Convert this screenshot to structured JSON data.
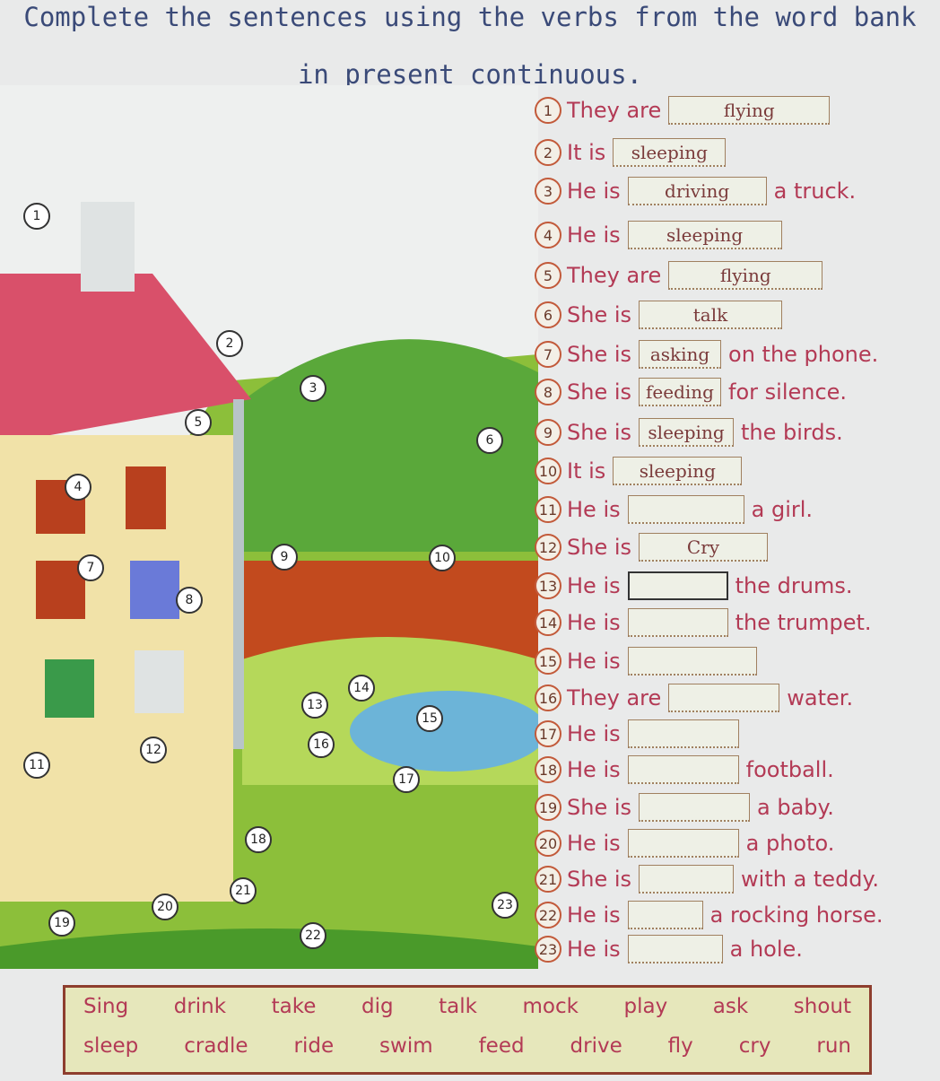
{
  "title_line1": "Complete the sentences using the verbs from the word bank",
  "title_line2": "in present continuous.",
  "sentences": [
    {
      "n": "1",
      "before": "They are",
      "answer": "flying",
      "after": ""
    },
    {
      "n": "2",
      "before": "It is",
      "answer": "sleeping",
      "after": ""
    },
    {
      "n": "3",
      "before": "He is",
      "answer": "driving",
      "after": "a truck."
    },
    {
      "n": "4",
      "before": "He is",
      "answer": "sleeping",
      "after": ""
    },
    {
      "n": "5",
      "before": "They are",
      "answer": "flying",
      "after": ""
    },
    {
      "n": "6",
      "before": "She is",
      "answer": "talk",
      "after": ""
    },
    {
      "n": "7",
      "before": "She is",
      "answer": "asking",
      "after": "on the phone."
    },
    {
      "n": "8",
      "before": "She is",
      "answer": "feeding",
      "after": "for silence."
    },
    {
      "n": "9",
      "before": "She is",
      "answer": "sleeping",
      "after": "the birds."
    },
    {
      "n": "10",
      "before": "It is",
      "answer": "sleeping",
      "after": ""
    },
    {
      "n": "11",
      "before": "He is",
      "answer": "",
      "after": "a girl."
    },
    {
      "n": "12",
      "before": "She is",
      "answer": "Cry",
      "after": ""
    },
    {
      "n": "13",
      "before": "He is",
      "answer": "",
      "after": "the drums."
    },
    {
      "n": "14",
      "before": "He is",
      "answer": "",
      "after": "the trumpet."
    },
    {
      "n": "15",
      "before": "He is",
      "answer": "",
      "after": ""
    },
    {
      "n": "16",
      "before": "They are",
      "answer": "",
      "after": "water."
    },
    {
      "n": "17",
      "before": "He is",
      "answer": "",
      "after": ""
    },
    {
      "n": "18",
      "before": "He is",
      "answer": "",
      "after": "football."
    },
    {
      "n": "19",
      "before": "She is",
      "answer": "",
      "after": "a baby."
    },
    {
      "n": "20",
      "before": "He is",
      "answer": "",
      "after": "a photo."
    },
    {
      "n": "21",
      "before": "She is",
      "answer": "",
      "after": "with a teddy."
    },
    {
      "n": "22",
      "before": "He is",
      "answer": "",
      "after": "a rocking horse."
    },
    {
      "n": "23",
      "before": "He is",
      "answer": "",
      "after": "a hole."
    }
  ],
  "word_bank": {
    "row1": [
      "Sing",
      "drink",
      "take",
      "dig",
      "talk",
      "mock",
      "play",
      "ask",
      "shout"
    ],
    "row2": [
      "sleep",
      "cradle",
      "ride",
      "swim",
      "feed",
      "drive",
      "fly",
      "cry",
      "run"
    ]
  },
  "scene_labels": [
    "1",
    "2",
    "3",
    "4",
    "5",
    "6",
    "7",
    "8",
    "9",
    "10",
    "11",
    "12",
    "13",
    "14",
    "15",
    "16",
    "17",
    "18",
    "19",
    "20",
    "21",
    "22",
    "23"
  ],
  "colors": {
    "text": "#b33a55",
    "title": "#3a4a78",
    "bank_bg": "#e6e7bb",
    "bank_border": "#8e3e2e"
  }
}
